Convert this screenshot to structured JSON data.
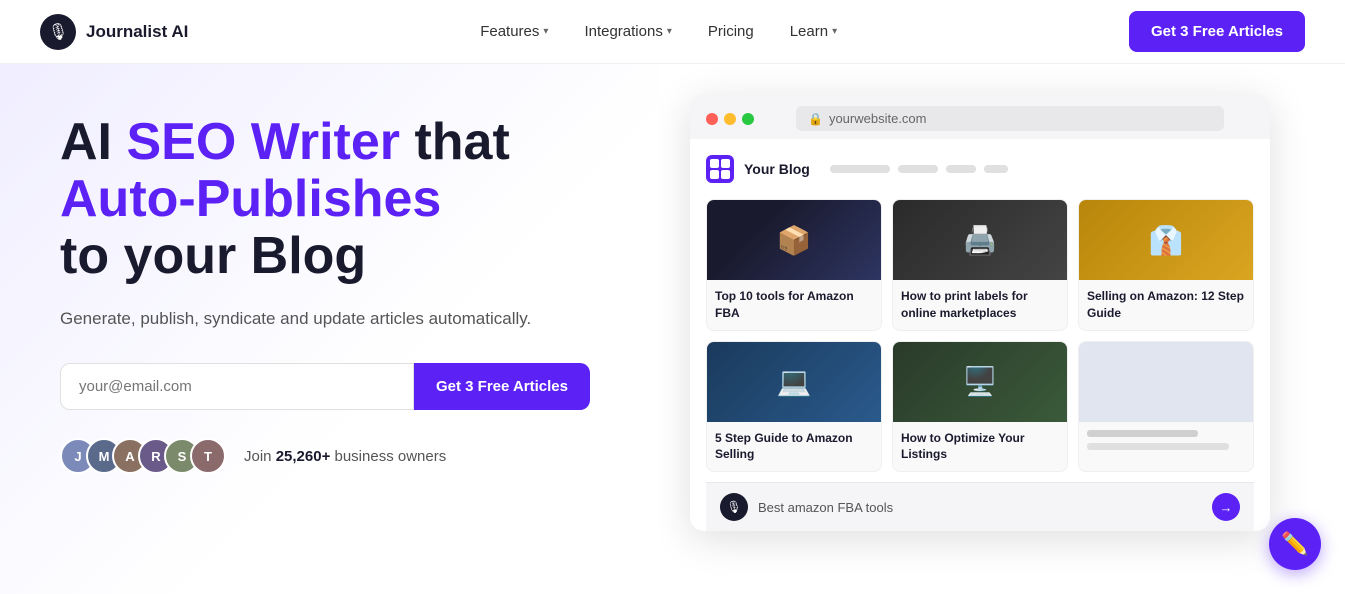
{
  "navbar": {
    "logo_text": "Journalist AI",
    "logo_icon": "🎙",
    "nav_items": [
      {
        "label": "Features",
        "has_dropdown": true
      },
      {
        "label": "Integrations",
        "has_dropdown": true
      },
      {
        "label": "Pricing",
        "has_dropdown": false
      },
      {
        "label": "Learn",
        "has_dropdown": true
      }
    ],
    "cta_label": "Get 3 Free Articles"
  },
  "hero": {
    "title_part1": "AI ",
    "title_purple": "SEO Writer",
    "title_part2": " that",
    "title_line2": "Auto-Publishes",
    "title_line3": "to your Blog",
    "subtitle": "Generate, publish, syndicate and update articles automatically.",
    "email_placeholder": "your@email.com",
    "cta_label": "Get 3 Free Articles",
    "social_proof_text": "Join ",
    "social_count": "25,260+",
    "social_suffix": " business owners"
  },
  "browser": {
    "url": "yourwebsite.com",
    "blog_title": "Your Blog",
    "articles": [
      {
        "title": "Top 10 tools for Amazon FBA",
        "emoji": "📦",
        "bg": "amazon"
      },
      {
        "title": "How to print labels for online marketplaces",
        "emoji": "🖨️",
        "bg": "labels"
      },
      {
        "title": "Selling on Amazon: 12 Step Guide",
        "emoji": "👔",
        "bg": "selling"
      },
      {
        "title": "5 Step Guide to Amazon Selling",
        "emoji": "💻",
        "bg": "step"
      },
      {
        "title": "How to Optimize Your Listings",
        "emoji": "🖥️",
        "bg": "optimize"
      },
      {
        "title": "",
        "emoji": "",
        "bg": "blank"
      }
    ],
    "chat_placeholder": "Best amazon FBA tools"
  },
  "chat_widget": {
    "icon": "✏️"
  },
  "avatars": [
    {
      "initials": "J"
    },
    {
      "initials": "M"
    },
    {
      "initials": "A"
    },
    {
      "initials": "R"
    },
    {
      "initials": "S"
    },
    {
      "initials": "T"
    }
  ]
}
